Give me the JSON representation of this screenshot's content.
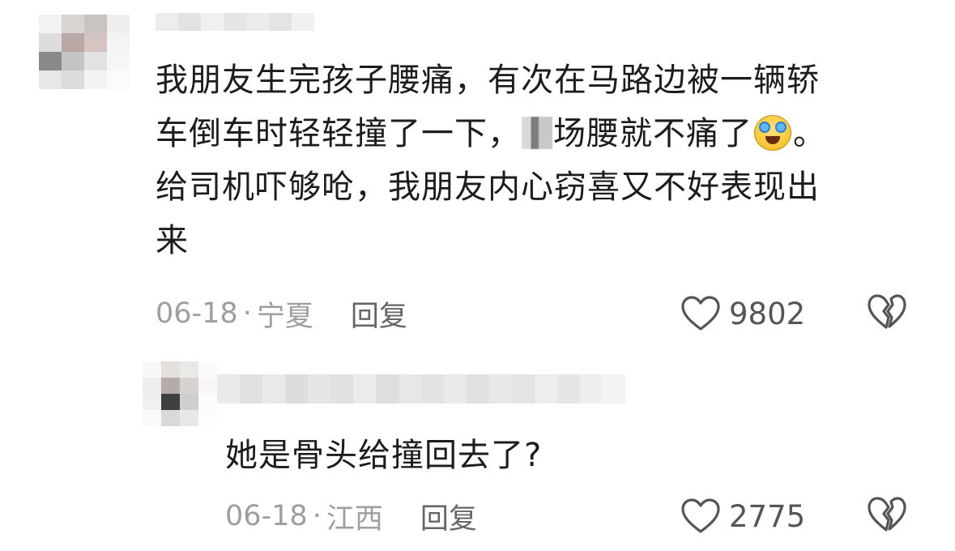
{
  "comment": {
    "text_line1": "我朋友生完孩子腰痛，有次在马路边被一辆轿",
    "text_line2a": "车倒车时轻轻撞了一下，",
    "text_line2b": "场腰就不痛了",
    "text_line2c": "。",
    "text_line3": "给司机吓够呛，我朋友内心窃喜又不好表现出",
    "text_line4": "来",
    "emoji": "crying-laughing-emoji",
    "date": "06-18",
    "separator": "·",
    "location": "宁夏",
    "reply_label": "回复",
    "like_count": "9802"
  },
  "reply": {
    "text": "她是骨头给撞回去了?",
    "date": "06-18",
    "separator": "·",
    "location": "江西",
    "reply_label": "回复",
    "like_count": "2775"
  },
  "colors": {
    "text": "#1c1c1c",
    "meta": "#9e9e9e",
    "reply_button": "#666666",
    "icon_stroke": "#555555",
    "background": "#ffffff"
  }
}
